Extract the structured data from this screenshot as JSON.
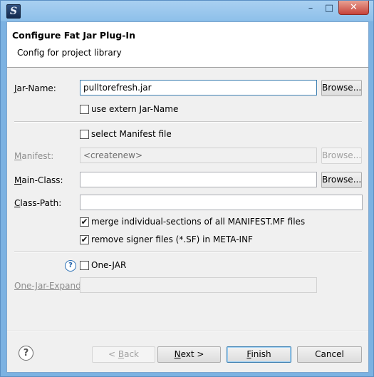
{
  "window": {
    "icon_glyph": "S",
    "minimize": "–",
    "maximize": "□",
    "close": "✕"
  },
  "header": {
    "title": "Configure Fat Jar Plug-In",
    "subtitle": "Config for project library"
  },
  "jar_name": {
    "label": "ar-Name:",
    "label_mnemonic": "J",
    "value": "pulltorefresh.jar",
    "browse": "Browse..."
  },
  "use_extern": {
    "label": "use extern Jar-Name",
    "checked": false
  },
  "select_manifest": {
    "label": "select Manifest file",
    "checked": false
  },
  "manifest": {
    "label": "anifest:",
    "label_mnemonic": "M",
    "value": "<createnew>",
    "browse": "Browse..."
  },
  "main_class": {
    "label": "ain-Class:",
    "label_mnemonic": "M",
    "value": "",
    "browse": "Browse..."
  },
  "class_path": {
    "label": "lass-Path:",
    "label_mnemonic": "C",
    "value": ""
  },
  "merge_sections": {
    "label": "merge individual-sections of all MANIFEST.MF files",
    "checked": true
  },
  "remove_signer": {
    "label": "remove signer files (*.SF) in META-INF",
    "checked": true
  },
  "one_jar": {
    "label": "One-JAR",
    "checked": false,
    "help_glyph": "?"
  },
  "one_jar_expand": {
    "label": "One-Jar-Expand:",
    "value": ""
  },
  "footer": {
    "help_glyph": "?",
    "back_pre": "< ",
    "back_mn": "B",
    "back_post": "ack",
    "next_mn": "N",
    "next_post": "ext >",
    "finish_mn": "F",
    "finish_post": "inish",
    "cancel": "Cancel"
  },
  "check_mark": "✔"
}
